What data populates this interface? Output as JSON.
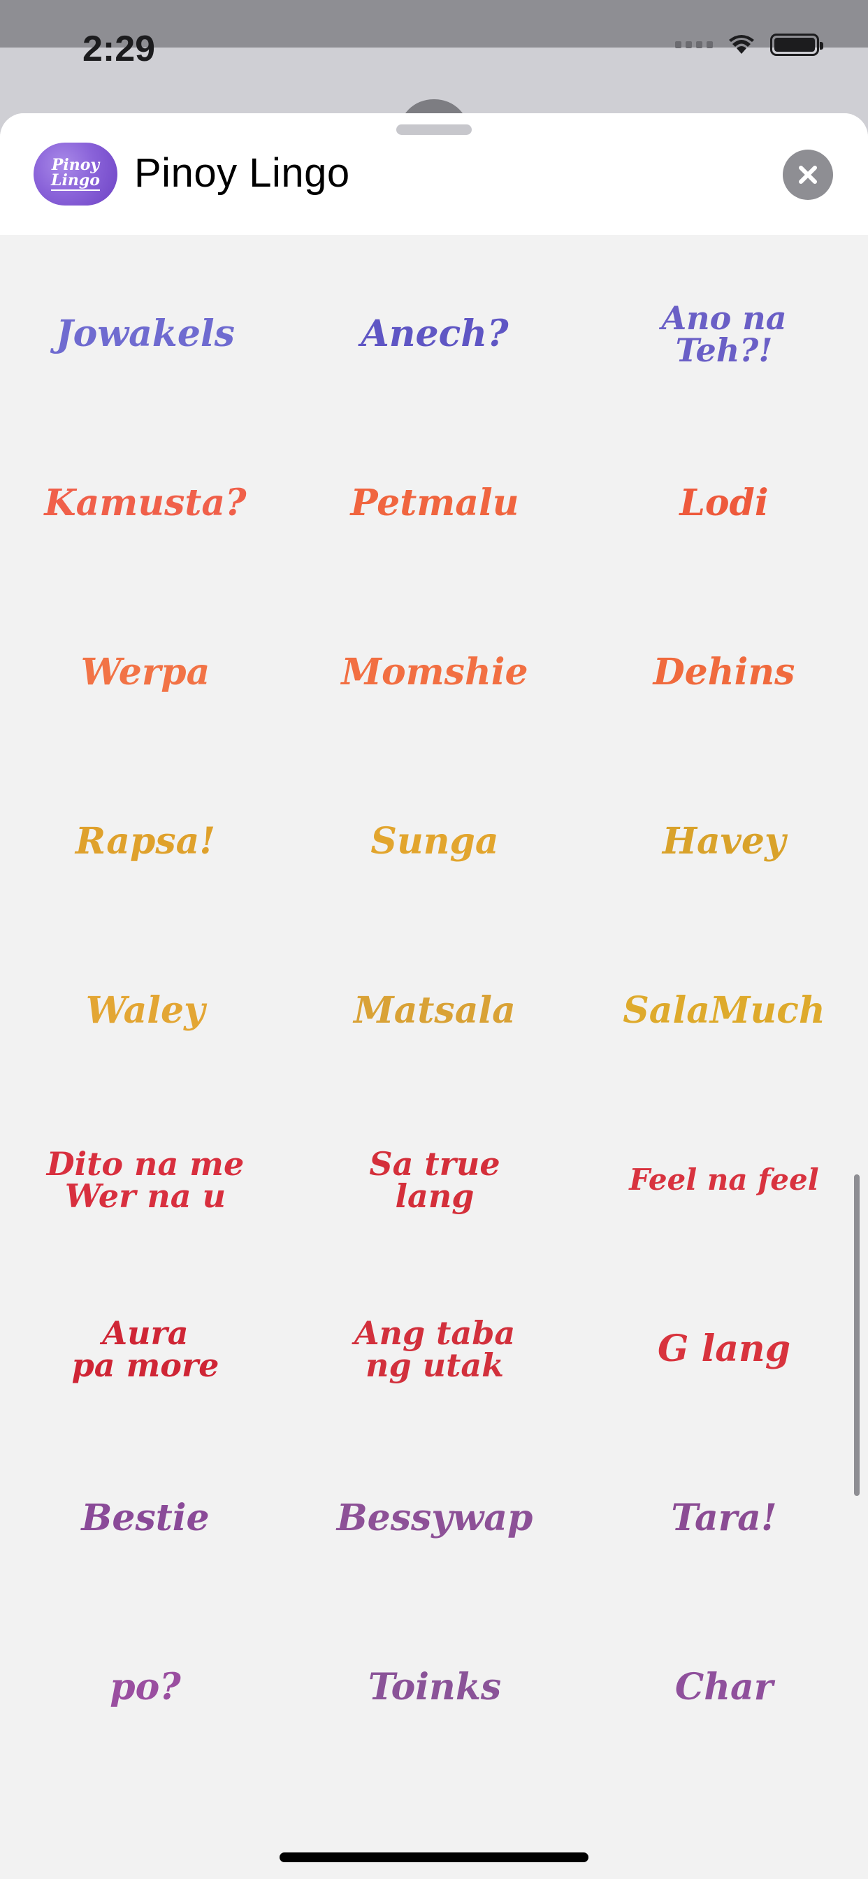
{
  "status_bar": {
    "time": "2:29"
  },
  "header": {
    "app_icon_lines": [
      "Pinoy",
      "Lingo"
    ],
    "title": "Pinoy Lingo",
    "close_icon": "close-icon"
  },
  "stickers": [
    {
      "label": "Jowakels",
      "color": "#6f6bd0"
    },
    {
      "label": "Anech?",
      "color": "#5f56c4"
    },
    {
      "label": "Ano na\nTeh?!",
      "color": "#6a5fc6"
    },
    {
      "label": "Kamusta?",
      "color": "#f0604a"
    },
    {
      "label": "Petmalu",
      "color": "#f0653f"
    },
    {
      "label": "Lodi",
      "color": "#ee5a3c"
    },
    {
      "label": "Werpa",
      "color": "#f27346"
    },
    {
      "label": "Momshie",
      "color": "#f26f42"
    },
    {
      "label": "Dehins",
      "color": "#f06a3d"
    },
    {
      "label": "Rapsa!",
      "color": "#dfa12c"
    },
    {
      "label": "Sunga",
      "color": "#e2a52d"
    },
    {
      "label": "Havey",
      "color": "#d9a22a"
    },
    {
      "label": "Waley",
      "color": "#e3a634"
    },
    {
      "label": "Matsala",
      "color": "#d9a236"
    },
    {
      "label": "SalaMuch",
      "color": "#deaa2c"
    },
    {
      "label": "Dito na me\nWer na u",
      "color": "#d82f3e"
    },
    {
      "label": "Sa true\nlang",
      "color": "#d42f3a"
    },
    {
      "label": "Feel na feel",
      "color": "#d8333f"
    },
    {
      "label": "Aura\npa more",
      "color": "#cf2535"
    },
    {
      "label": "Ang taba\nng utak",
      "color": "#d2303c"
    },
    {
      "label": "G lang",
      "color": "#d8333d"
    },
    {
      "label": "Bestie",
      "color": "#8a4a98"
    },
    {
      "label": "Bessywap",
      "color": "#8d5197"
    },
    {
      "label": "Tara!",
      "color": "#8b4c94"
    },
    {
      "label": "po?",
      "color": "#9a4ea0"
    },
    {
      "label": "Toinks",
      "color": "#8a5398"
    },
    {
      "label": "Char",
      "color": "#8f509c"
    }
  ]
}
